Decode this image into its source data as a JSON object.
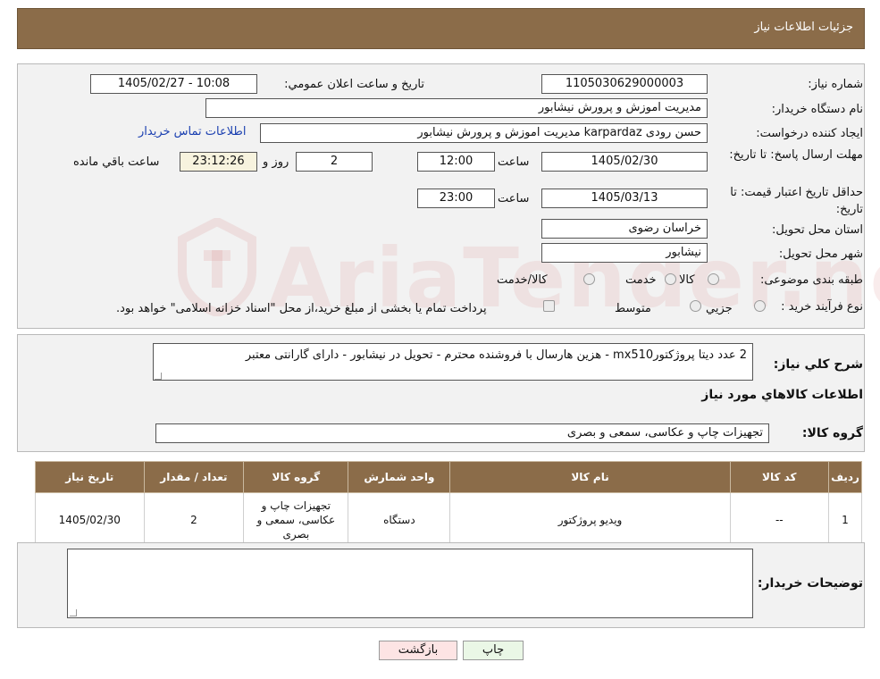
{
  "header": {
    "title": "جزئیات اطلاعات نیاز"
  },
  "watermark": {
    "text": "AriaTender.neT"
  },
  "form": {
    "need_number": {
      "label": "شماره نیاز:",
      "value": "1105030629000003"
    },
    "announce_datetime": {
      "label": "تاریخ و ساعت اعلان عمومي:",
      "value": "1405/02/27 - 10:08"
    },
    "buyer_org": {
      "label": "نام دستگاه خریدار:",
      "value": "مدیریت اموزش و پرورش نیشابور"
    },
    "requester": {
      "label": "ایجاد کننده درخواست:",
      "value": "حسن رودی karpardaz مدیریت اموزش و پرورش نیشابور",
      "contact_link": "اطلاعات تماس خریدار"
    },
    "reply_deadline": {
      "label": "مهلت ارسال پاسخ: تا تاریخ:",
      "date": "1405/02/30",
      "time_label": "ساعت",
      "time": "12:00",
      "days": "2",
      "days_label": "روز و",
      "remaining": "23:12:26",
      "remaining_label": "ساعت باقي مانده"
    },
    "price_validity": {
      "label": "حداقل تاریخ اعتبار قیمت: تا تاریخ:",
      "date": "1405/03/13",
      "time_label": "ساعت",
      "time": "23:00"
    },
    "province": {
      "label": "استان محل تحویل:",
      "value": "خراسان رضوی"
    },
    "city": {
      "label": "شهر محل تحویل:",
      "value": "نیشابور"
    },
    "category": {
      "label": "طبقه بندی موضوعی:",
      "options": [
        "کالا",
        "خدمت",
        "کالا/خدمت"
      ]
    },
    "process_type": {
      "label": "نوع فرآیند خرید :",
      "options": [
        "جزیي",
        "متوسط"
      ],
      "note": "پرداخت تمام یا بخشی از مبلغ خرید،از محل \"اسناد خزانه اسلامی\" خواهد بود."
    }
  },
  "description": {
    "label": "شرح کلي نیاز:",
    "value": "2 عدد دیتا پروژکتورmx510 - هزین هارسال با فروشنده محترم - تحویل در نیشابور - دارای گارانتی معتبر"
  },
  "goods_section": {
    "title": "اطلاعات کالاهاي مورد نیاز",
    "group_label": "گروه کالا:",
    "group_value": "تجهیزات چاپ و عکاسی، سمعی و بصری"
  },
  "table": {
    "headers": [
      "ردیف",
      "کد کالا",
      "نام کالا",
      "واحد شمارش",
      "گروه کالا",
      "تعداد / مقدار",
      "تاریخ نیاز"
    ],
    "rows": [
      {
        "row": "1",
        "code": "--",
        "name": "ویدیو پروژکتور",
        "unit": "دستگاه",
        "group": "تجهیزات چاپ و عکاسی، سمعی و بصری",
        "qty": "2",
        "date": "1405/02/30"
      }
    ]
  },
  "buyer_notes": {
    "label": "توضیحات خریدار:",
    "value": ""
  },
  "buttons": {
    "print": "چاپ",
    "back": "بازگشت"
  },
  "colors": {
    "header_bg": "#8b6c49",
    "back_btn_bg": "#fde4e4",
    "print_btn_bg": "#eaf7e6"
  }
}
